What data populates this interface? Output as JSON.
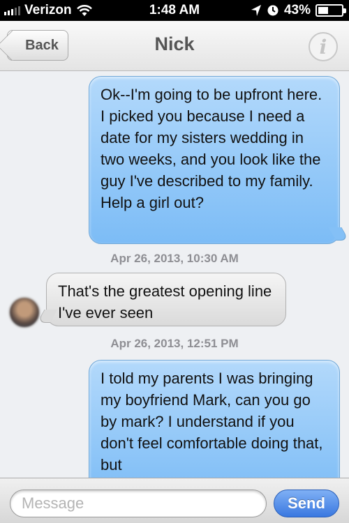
{
  "status_bar": {
    "carrier": "Verizon",
    "time": "1:48 AM",
    "battery": "43%",
    "battery_level": 0.43,
    "icons": [
      "signal-icon",
      "wifi-icon",
      "location-arrow-icon",
      "alarm-clock-icon",
      "battery-icon"
    ]
  },
  "nav": {
    "back_label": "Back",
    "title": "Nick",
    "info_glyph": "i"
  },
  "messages": [
    {
      "direction": "sent",
      "text": "Ok--I'm going to be upfront here. I picked you because I need a date for my sisters wedding in two weeks, and you look like the guy I've described to my family. Help a girl out?"
    },
    {
      "direction": "timestamp",
      "text": "Apr 26, 2013, 10:30 AM"
    },
    {
      "direction": "received",
      "text": "That's the greatest opening line I've ever seen"
    },
    {
      "direction": "timestamp",
      "text": "Apr 26, 2013, 12:51 PM"
    },
    {
      "direction": "sent",
      "text": "I told my parents I was bringing my boyfriend Mark, can you go by mark? I understand if you don't feel comfortable doing that, but"
    }
  ],
  "composer": {
    "placeholder": "Message",
    "send_label": "Send"
  },
  "colors": {
    "sent_bubble": "#8cc4f7",
    "received_bubble": "#e6e6e6",
    "send_button": "#3a78e0"
  }
}
